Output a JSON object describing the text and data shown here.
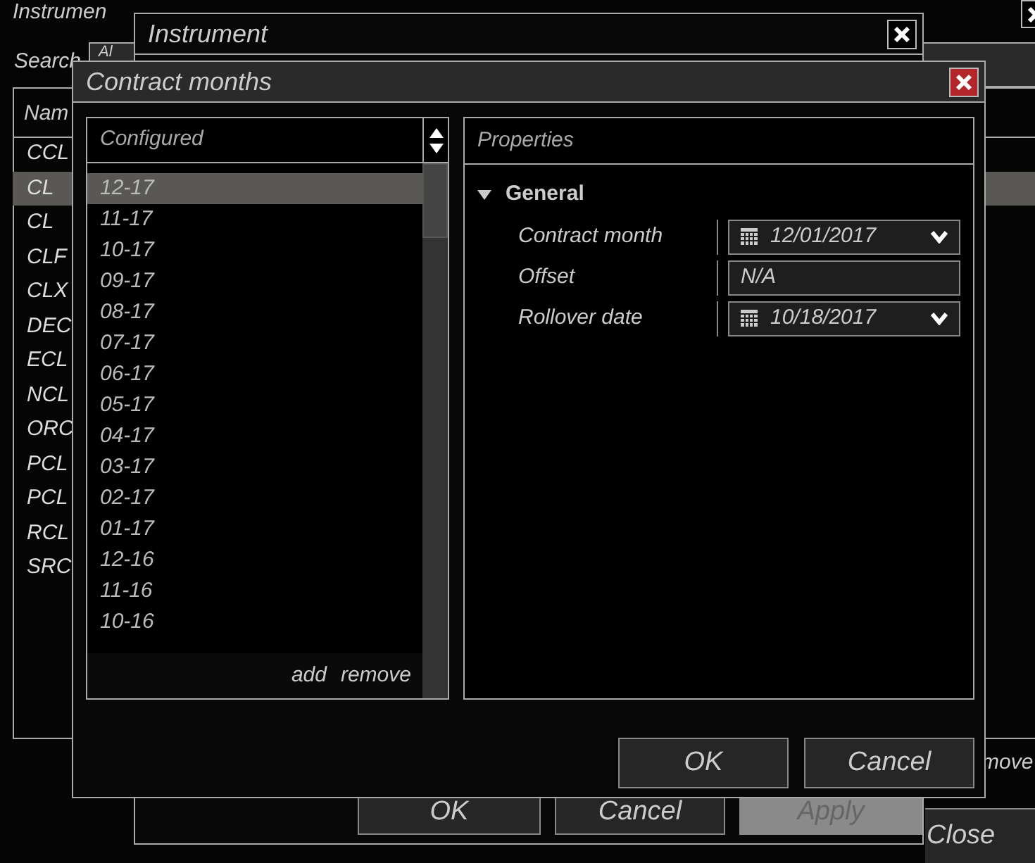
{
  "background_window": {
    "title": "Instrumen",
    "search": {
      "label": "Search",
      "value": "Al"
    },
    "list": {
      "column": "Nam",
      "rows": [
        {
          "label": "CCL",
          "selected": false
        },
        {
          "label": "CL",
          "selected": true
        },
        {
          "label": "CL",
          "selected": false
        },
        {
          "label": "CLF",
          "selected": false
        },
        {
          "label": "CLX",
          "selected": false
        },
        {
          "label": "DEC",
          "selected": false
        },
        {
          "label": "ECL",
          "selected": false
        },
        {
          "label": "NCL",
          "selected": false
        },
        {
          "label": "ORC",
          "selected": false
        },
        {
          "label": "PCL",
          "selected": false
        },
        {
          "label": "PCL",
          "selected": false
        },
        {
          "label": "RCL",
          "selected": false
        },
        {
          "label": "SRC",
          "selected": false
        }
      ]
    },
    "remove_link": "move",
    "close_button": "Close"
  },
  "instrument_window": {
    "title": "Instrument",
    "buttons": [
      {
        "label": "OK",
        "disabled": false
      },
      {
        "label": "Cancel",
        "disabled": false
      },
      {
        "label": "Apply",
        "disabled": true
      }
    ]
  },
  "dialog": {
    "title": "Contract months",
    "configured": {
      "header": "Configured",
      "items": [
        {
          "label": "12-17",
          "selected": true
        },
        {
          "label": "11-17",
          "selected": false
        },
        {
          "label": "10-17",
          "selected": false
        },
        {
          "label": "09-17",
          "selected": false
        },
        {
          "label": "08-17",
          "selected": false
        },
        {
          "label": "07-17",
          "selected": false
        },
        {
          "label": "06-17",
          "selected": false
        },
        {
          "label": "05-17",
          "selected": false
        },
        {
          "label": "04-17",
          "selected": false
        },
        {
          "label": "03-17",
          "selected": false
        },
        {
          "label": "02-17",
          "selected": false
        },
        {
          "label": "01-17",
          "selected": false
        },
        {
          "label": "12-16",
          "selected": false
        },
        {
          "label": "11-16",
          "selected": false
        },
        {
          "label": "10-16",
          "selected": false
        }
      ],
      "actions": [
        "add",
        "remove"
      ]
    },
    "properties": {
      "header": "Properties",
      "groups": [
        {
          "label": "General",
          "expanded": true,
          "rows": [
            {
              "label": "Contract month",
              "kind": "date",
              "value": "12/01/2017"
            },
            {
              "label": "Offset",
              "kind": "text",
              "value": "N/A"
            },
            {
              "label": "Rollover date",
              "kind": "date",
              "value": "10/18/2017"
            }
          ]
        }
      ]
    },
    "buttons": [
      "OK",
      "Cancel"
    ]
  }
}
